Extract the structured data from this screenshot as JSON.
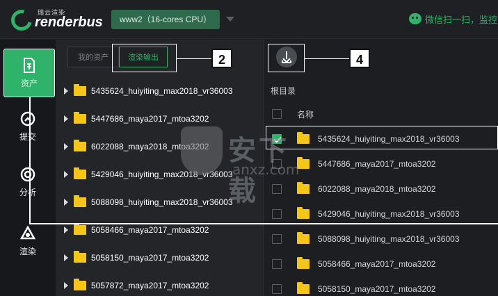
{
  "app": {
    "logo_sub": "瑞云渲染",
    "logo_text": "renderbus",
    "cpu_select": "www2（16-cores CPU）",
    "wechat_text": "微信扫一扫，监控"
  },
  "nav": {
    "items": [
      {
        "label": "资产",
        "icon": "document-icon"
      },
      {
        "label": "提交",
        "icon": "upload-icon"
      },
      {
        "label": "分析",
        "icon": "target-icon"
      },
      {
        "label": "渲染",
        "icon": "render-icon"
      }
    ]
  },
  "tabs": {
    "assets": "我的资产",
    "render_output": "渲染输出"
  },
  "callouts": {
    "tab": "2",
    "download": "4"
  },
  "tree": [
    "5435624_huiyiting_max2018_vr36003",
    "5447686_maya2017_mtoa3202",
    "6022088_maya2018_mtoa3202",
    "5429046_huiyiting_max2018_vr36003",
    "5088098_huiyiting_max2018_vr36003",
    "5058466_maya2017_mtoa3202",
    "5058150_maya2017_mtoa3202",
    "5057872_maya2017_mtoa3202"
  ],
  "right": {
    "root_label": "根目录",
    "col_name": "名称",
    "files": [
      {
        "name": "5435624_huiyiting_max2018_vr36003",
        "checked": true
      },
      {
        "name": "5447686_maya2017_mtoa3202",
        "checked": false
      },
      {
        "name": "6022088_maya2018_mtoa3202",
        "checked": false
      },
      {
        "name": "5429046_huiyiting_max2018_vr36003",
        "checked": false
      },
      {
        "name": "5088098_huiyiting_max2018_vr36003",
        "checked": false
      },
      {
        "name": "5058466_maya2017_mtoa3202",
        "checked": false
      },
      {
        "name": "5058150_maya2017_mtoa3202",
        "checked": false
      }
    ]
  },
  "watermark": {
    "text": "安下载",
    "sub": "anxz.com"
  },
  "colors": {
    "accent": "#2fb36a",
    "folder": "#f5c518"
  }
}
